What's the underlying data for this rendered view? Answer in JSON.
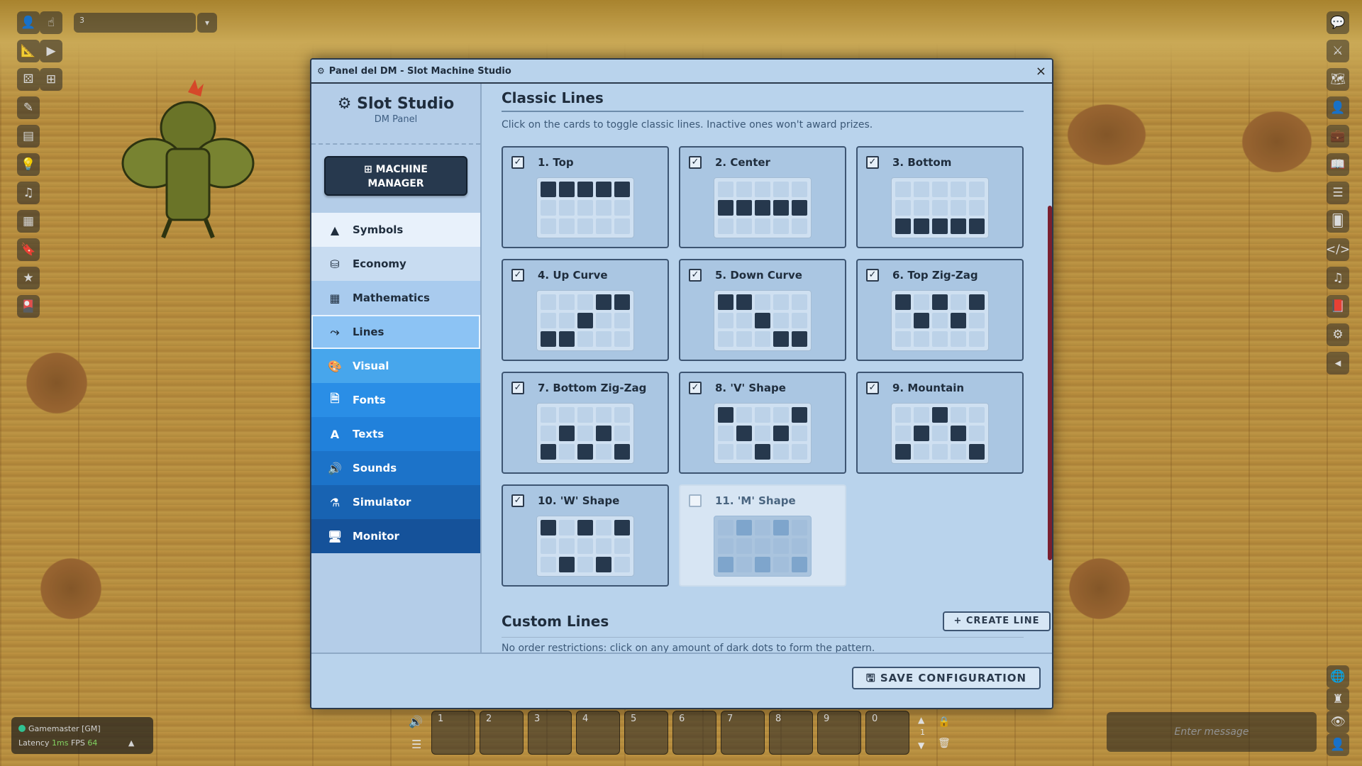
{
  "modal": {
    "title": "Panel del DM - Slot Machine Studio",
    "close": "×"
  },
  "brand": {
    "title": "Slot Studio",
    "subtitle": "DM Panel"
  },
  "machine_manager": {
    "label_line1": "⊞ MACHINE",
    "label_line2": "MANAGER"
  },
  "nav": [
    {
      "label": "Symbols",
      "icon": "shapes-icon",
      "bg": "#e8f1fb"
    },
    {
      "label": "Economy",
      "icon": "coins-icon",
      "bg": "#c8dcf1"
    },
    {
      "label": "Mathematics",
      "icon": "calculator-icon",
      "bg": "#a9cbee"
    },
    {
      "label": "Lines",
      "icon": "route-icon",
      "bg": "#8cc3f4"
    },
    {
      "label": "Visual",
      "icon": "palette-icon",
      "bg": "#47a6ec"
    },
    {
      "label": "Fonts",
      "icon": "font-file-icon",
      "bg": "#2a8ee6"
    },
    {
      "label": "Texts",
      "icon": "letter-a-icon",
      "bg": "#2181db"
    },
    {
      "label": "Sounds",
      "icon": "speaker-icon",
      "bg": "#1c73c9"
    },
    {
      "label": "Simulator",
      "icon": "flask-icon",
      "bg": "#1863b2"
    },
    {
      "label": "Monitor",
      "icon": "monitor-icon",
      "bg": "#15529a"
    }
  ],
  "classic": {
    "title": "Classic Lines",
    "description": "Click on the cards to toggle classic lines. Inactive ones won't award prizes."
  },
  "lines": [
    {
      "title": "1. Top",
      "active": true,
      "pattern": [
        1,
        1,
        1,
        1,
        1,
        0,
        0,
        0,
        0,
        0,
        0,
        0,
        0,
        0,
        0
      ]
    },
    {
      "title": "2. Center",
      "active": true,
      "pattern": [
        0,
        0,
        0,
        0,
        0,
        1,
        1,
        1,
        1,
        1,
        0,
        0,
        0,
        0,
        0
      ]
    },
    {
      "title": "3. Bottom",
      "active": true,
      "pattern": [
        0,
        0,
        0,
        0,
        0,
        0,
        0,
        0,
        0,
        0,
        1,
        1,
        1,
        1,
        1
      ]
    },
    {
      "title": "4. Up Curve",
      "active": true,
      "pattern": [
        0,
        0,
        0,
        1,
        1,
        0,
        0,
        1,
        0,
        0,
        1,
        1,
        0,
        0,
        0
      ]
    },
    {
      "title": "5. Down Curve",
      "active": true,
      "pattern": [
        1,
        1,
        0,
        0,
        0,
        0,
        0,
        1,
        0,
        0,
        0,
        0,
        0,
        1,
        1
      ]
    },
    {
      "title": "6. Top Zig-Zag",
      "active": true,
      "pattern": [
        1,
        0,
        1,
        0,
        1,
        0,
        1,
        0,
        1,
        0,
        0,
        0,
        0,
        0,
        0
      ]
    },
    {
      "title": "7. Bottom Zig-Zag",
      "active": true,
      "pattern": [
        0,
        0,
        0,
        0,
        0,
        0,
        1,
        0,
        1,
        0,
        1,
        0,
        1,
        0,
        1
      ]
    },
    {
      "title": "8. 'V' Shape",
      "active": true,
      "pattern": [
        1,
        0,
        0,
        0,
        1,
        0,
        1,
        0,
        1,
        0,
        0,
        0,
        1,
        0,
        0
      ]
    },
    {
      "title": "9. Mountain",
      "active": true,
      "pattern": [
        0,
        0,
        1,
        0,
        0,
        0,
        1,
        0,
        1,
        0,
        1,
        0,
        0,
        0,
        1
      ]
    },
    {
      "title": "10. 'W' Shape",
      "active": true,
      "pattern": [
        1,
        0,
        1,
        0,
        1,
        0,
        0,
        0,
        0,
        0,
        0,
        1,
        0,
        1,
        0
      ]
    },
    {
      "title": "11. 'M' Shape",
      "active": false,
      "pattern": [
        0,
        1,
        0,
        1,
        0,
        0,
        0,
        0,
        0,
        0,
        1,
        0,
        1,
        0,
        1
      ]
    }
  ],
  "custom": {
    "title": "Custom Lines",
    "create_label": "+ CREATE LINE",
    "description": "No order restrictions: click on any amount of dark dots to form the pattern."
  },
  "footer": {
    "save_label": "🖫 SAVE CONFIGURATION"
  },
  "vtt": {
    "topbar_value": "3",
    "user": "Gamemaster [GM]",
    "latency_label": "Latency",
    "latency_value": "1ms",
    "fps_label": "FPS",
    "fps_value": "64",
    "hotbar": [
      "1",
      "2",
      "3",
      "4",
      "5",
      "6",
      "7",
      "8",
      "9",
      "0"
    ],
    "hotbar_page": "1",
    "chat_placeholder": "Enter message"
  }
}
